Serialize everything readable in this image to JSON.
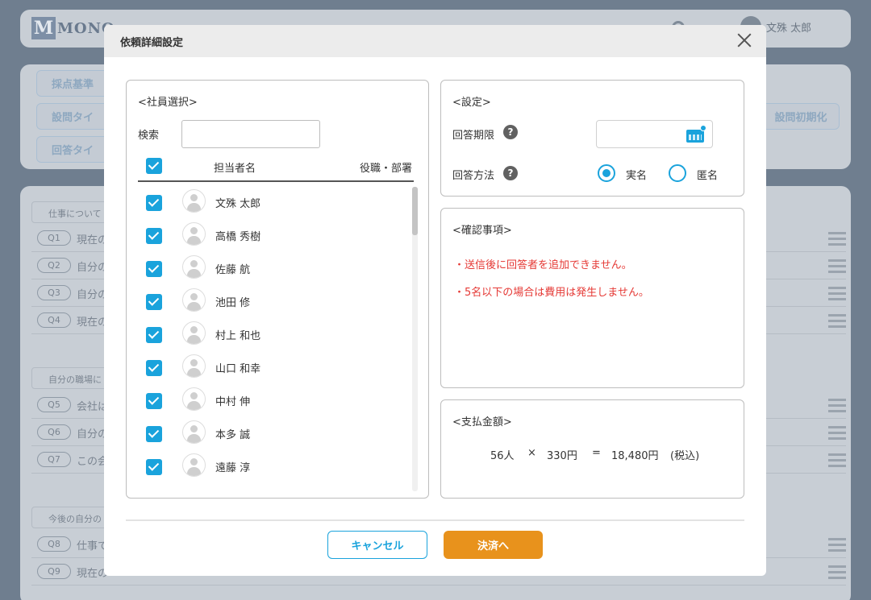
{
  "background": {
    "logo": {
      "mark": "M",
      "text": "MONO"
    },
    "header_user": "文殊 太郎",
    "filter_buttons": [
      "採点基準",
      "設問タイ",
      "回答タイ",
      "設問初期化"
    ],
    "sections": [
      {
        "label": "仕事について",
        "questions": [
          {
            "num": "Q1",
            "text": "現在の"
          },
          {
            "num": "Q2",
            "text": "自分の"
          },
          {
            "num": "Q3",
            "text": "自分の"
          },
          {
            "num": "Q4",
            "text": "現在の"
          }
        ]
      },
      {
        "label": "自分の職場に",
        "questions": [
          {
            "num": "Q5",
            "text": "会社は"
          },
          {
            "num": "Q6",
            "text": "自分の"
          },
          {
            "num": "Q7",
            "text": "この会"
          }
        ]
      },
      {
        "label": "今後の自分の",
        "questions": [
          {
            "num": "Q8",
            "text": "仕事で"
          },
          {
            "num": "Q9",
            "text": "現在の"
          }
        ]
      }
    ]
  },
  "modal": {
    "title": "依頼詳細設定",
    "employees": {
      "title": "<社員選択>",
      "search_label": "検索",
      "search_value": "",
      "col_name": "担当者名",
      "col_dept": "役職・部署",
      "rows": [
        {
          "name": "文殊 太郎",
          "checked": true
        },
        {
          "name": "高橋 秀樹",
          "checked": true
        },
        {
          "name": "佐藤 航",
          "checked": true
        },
        {
          "name": "池田 修",
          "checked": true
        },
        {
          "name": "村上 和也",
          "checked": true
        },
        {
          "name": "山口 和幸",
          "checked": true
        },
        {
          "name": "中村 伸",
          "checked": true
        },
        {
          "name": "本多 誠",
          "checked": true
        },
        {
          "name": "遠藤 淳",
          "checked": true
        }
      ]
    },
    "settings": {
      "title": "<設定>",
      "deadline_label": "回答期限",
      "deadline_value": "",
      "method_label": "回答方法",
      "method_options": [
        "実名",
        "匿名"
      ],
      "method_selected": "実名"
    },
    "notes": {
      "title": "<確認事項>",
      "lines": [
        "・送信後に回答者を追加できません。",
        "・5名以下の場合は費用は発生しません。"
      ]
    },
    "payment": {
      "title": "<支払金額>",
      "count": "56人",
      "times": "×",
      "unit": "330円",
      "equals": "=",
      "total": "18,480円",
      "tax": "(税込)"
    },
    "cancel_label": "キャンセル",
    "submit_label": "決済へ"
  },
  "colors": {
    "accent": "#1aa3dc",
    "warning": "#e53935",
    "primary_button": "#e8921c"
  }
}
